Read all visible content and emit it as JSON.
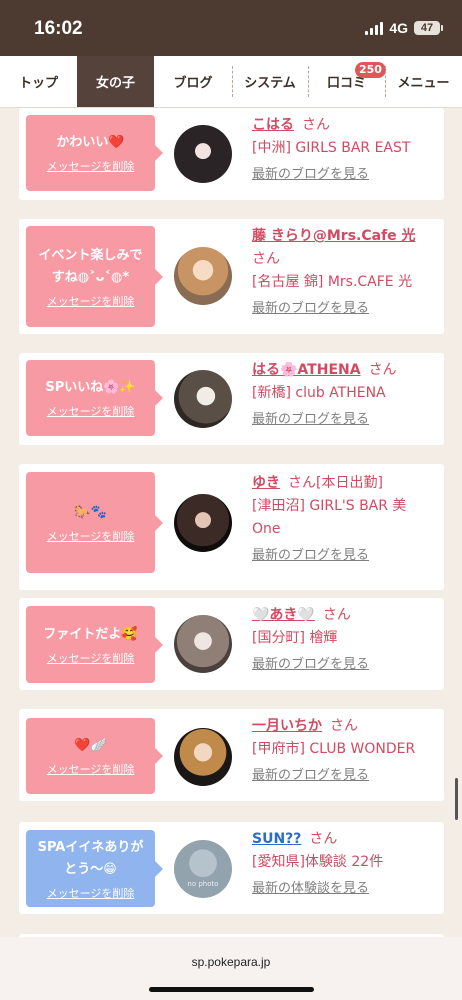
{
  "status_bar": {
    "time": "16:02",
    "network": "4G",
    "battery": "47"
  },
  "nav": {
    "tabs": [
      {
        "label": "トップ"
      },
      {
        "label": "女の子"
      },
      {
        "label": "ブログ"
      },
      {
        "label": "システム"
      },
      {
        "label": "口コミ"
      },
      {
        "label": "メニュー"
      }
    ],
    "active_tab": "女の子",
    "review_badge": "250"
  },
  "cards": [
    {
      "message": "かわいい❤️",
      "delete_label": "メッセージを削除",
      "name": "こはる",
      "suffix": "さん",
      "extra": "",
      "shop": "[中洲] GIRLS BAR EAST",
      "link": "最新のブログを見る"
    },
    {
      "message": "イベント楽しみで\nすね◍˃ᴗ˂◍*",
      "delete_label": "メッセージを削除",
      "name": "藤 きらり@Mrs.Cafe 光",
      "suffix": "さん",
      "extra": "",
      "shop": "[名古屋 錦] Mrs.CAFE 光",
      "link": "最新のブログを見る"
    },
    {
      "message": "SPいいね🌸✨",
      "delete_label": "メッセージを削除",
      "name": "はる🌸ATHENA",
      "suffix": "さん",
      "extra": "",
      "shop": "[新橋] club ATHENA",
      "link": "最新のブログを見る"
    },
    {
      "message": "🐎🐾",
      "delete_label": "メッセージを削除",
      "name": "ゆき",
      "suffix": "さん",
      "extra": "[本日出勤]",
      "shop": "[津田沼] GIRL'S BAR 美 One",
      "link": "最新のブログを見る"
    },
    {
      "message": "ファイトだよ🥰",
      "delete_label": "メッセージを削除",
      "name": "🤍あき🤍",
      "suffix": "さん",
      "extra": "",
      "shop": "[国分町] 檜輝",
      "link": "最新のブログを見る"
    },
    {
      "message": "❤️🪽",
      "delete_label": "メッセージを削除",
      "name": "一月いちか",
      "suffix": "さん",
      "extra": "",
      "shop": "[甲府市] CLUB WONDER",
      "link": "最新のブログを見る"
    },
    {
      "message": "SPAイイネありが\nとう〜😁",
      "delete_label": "メッセージを削除",
      "name": "SUN??",
      "suffix": "さん",
      "extra": "",
      "shop": "[愛知県]体験談 22件",
      "link": "最新の体験談を見る",
      "avatar_text": "no photo"
    }
  ],
  "browser": {
    "url": "sp.pokepara.jp"
  },
  "colors": {
    "status_bar": "#4d3b31",
    "active_tab": "#55423a",
    "page_bg": "#f4ede5",
    "bubble_pink": "#f79aa4",
    "bubble_blue": "#8fb4ee",
    "name_pink": "#d24a62",
    "name_blue": "#2c6ec4",
    "badge": "#e15757"
  }
}
